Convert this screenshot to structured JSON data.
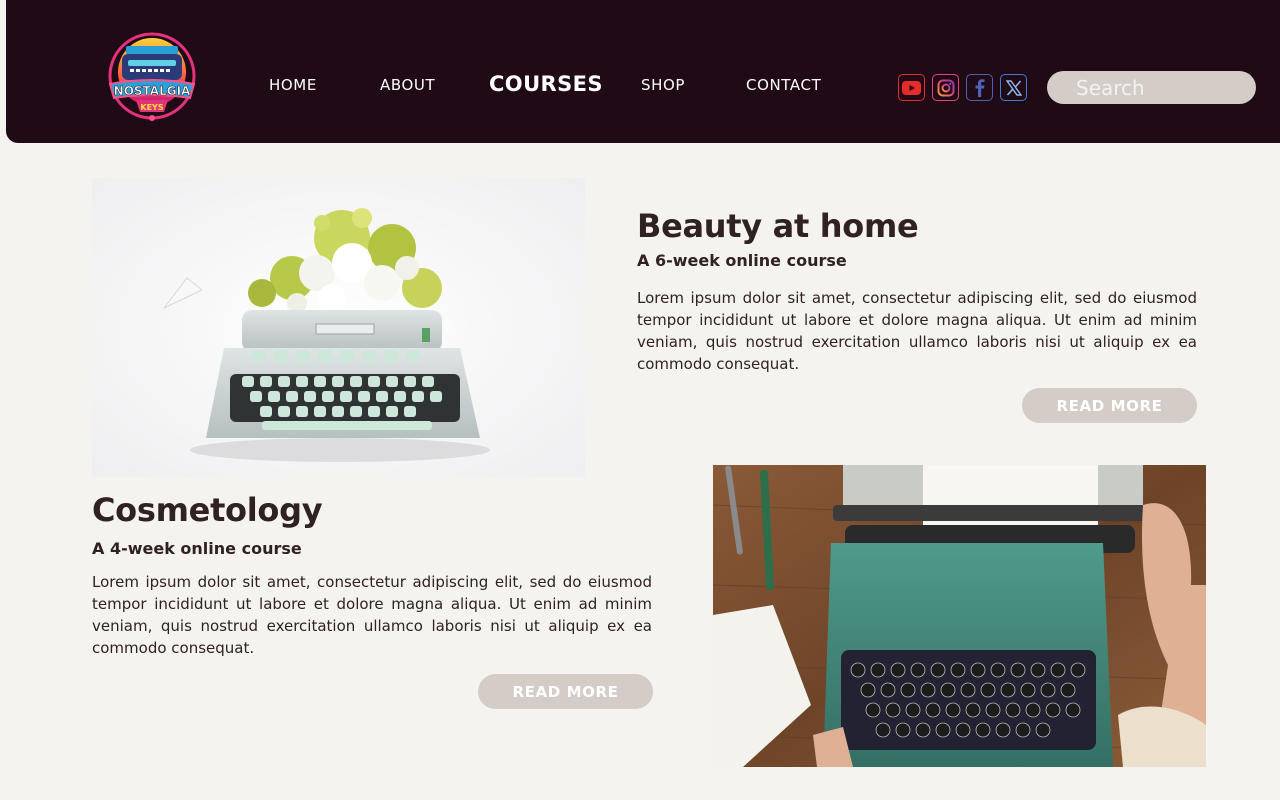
{
  "brand": {
    "logo_line1": "NOSTALGIA",
    "logo_line2": "KEYS",
    "logo_icon": "typewriter-logo"
  },
  "nav": {
    "items": [
      {
        "label": "HOME"
      },
      {
        "label": "ABOUT"
      },
      {
        "label": "COURSES",
        "active": true
      },
      {
        "label": "SHOP"
      },
      {
        "label": "CONTACT"
      }
    ]
  },
  "social": [
    {
      "icon": "youtube-icon",
      "color": "#e62b2b"
    },
    {
      "icon": "instagram-icon",
      "color": "#e0467c"
    },
    {
      "icon": "facebook-icon",
      "color": "#4b63b5"
    },
    {
      "icon": "x-icon",
      "color": "#3d7fd6"
    }
  ],
  "search": {
    "placeholder": "Search"
  },
  "courses": [
    {
      "title": "Beauty at home",
      "subtitle": "A 6-week online course",
      "description": "Lorem ipsum dolor sit amet, consectetur adipiscing elit, sed do eiusmod tempor incididunt ut labore et dolore magna aliqua. Ut enim ad minim veniam, quis nostrud exercitation ullamco laboris nisi ut aliquip ex ea commodo consequat.",
      "button": "READ MORE",
      "image": "white-typewriter-with-flowers-photo"
    },
    {
      "title": "Cosmetology",
      "subtitle": "A 4-week online course",
      "description": "Lorem ipsum dolor sit amet, consectetur adipiscing elit, sed do eiusmod tempor incididunt ut labore et dolore magna aliqua. Ut enim ad minim veniam, quis nostrud exercitation ullamco laboris nisi ut aliquip ex ea commodo consequat.",
      "button": "READ MORE",
      "image": "green-typewriter-on-desk-photo"
    }
  ],
  "colors": {
    "header_bg": "#1f0a16",
    "page_bg": "#f5f3f0",
    "button_bg": "#d4ccc7",
    "text": "#2f2220"
  }
}
